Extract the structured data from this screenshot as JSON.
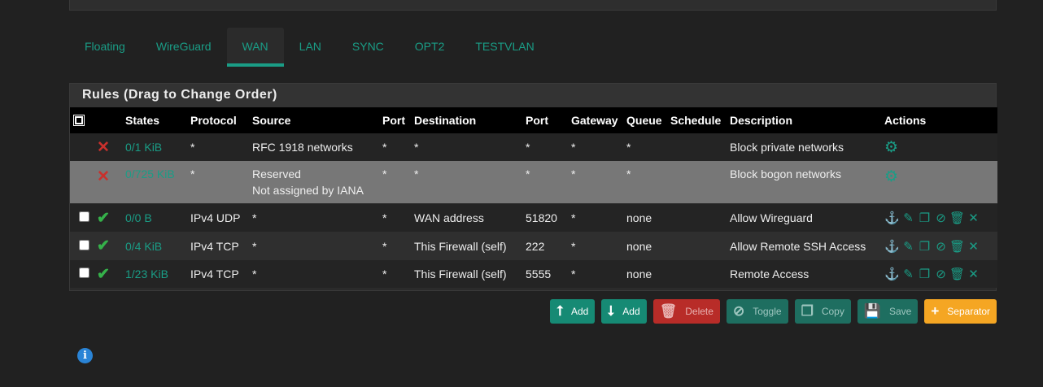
{
  "tabs": [
    {
      "label": "Floating",
      "active": false
    },
    {
      "label": "WireGuard",
      "active": false
    },
    {
      "label": "WAN",
      "active": true
    },
    {
      "label": "LAN",
      "active": false
    },
    {
      "label": "SYNC",
      "active": false
    },
    {
      "label": "OPT2",
      "active": false
    },
    {
      "label": "TESTVLAN",
      "active": false
    }
  ],
  "panel": {
    "title": "Rules (Drag to Change Order)"
  },
  "columns": [
    "States",
    "Protocol",
    "Source",
    "Port",
    "Destination",
    "Port",
    "Gateway",
    "Queue",
    "Schedule",
    "Description",
    "Actions"
  ],
  "rules": [
    {
      "status_icon": "block-x-icon",
      "states": "0/1 KiB",
      "protocol": "*",
      "source": "RFC 1918 networks",
      "source2": "",
      "sport": "*",
      "destination": "*",
      "dport": "*",
      "gateway": "*",
      "queue": "*",
      "schedule": "",
      "description": "Block private networks"
    },
    {
      "status_icon": "block-x-icon",
      "states": "0/725 KiB",
      "protocol": "*",
      "source": "Reserved",
      "source2": "Not assigned by IANA",
      "sport": "*",
      "destination": "*",
      "dport": "*",
      "gateway": "*",
      "queue": "*",
      "schedule": "",
      "description": "Block bogon networks"
    },
    {
      "status_icon": "pass-check-icon",
      "states": "0/0 B",
      "protocol": "IPv4 UDP",
      "source": "*",
      "source2": "",
      "sport": "*",
      "destination": "WAN address",
      "dport": "51820",
      "gateway": "*",
      "queue": "none",
      "schedule": "",
      "description": "Allow Wireguard"
    },
    {
      "status_icon": "pass-check-icon",
      "states": "0/4 KiB",
      "protocol": "IPv4 TCP",
      "source": "*",
      "source2": "",
      "sport": "*",
      "destination": "This Firewall (self)",
      "dport": "222",
      "gateway": "*",
      "queue": "none",
      "schedule": "",
      "description": "Allow Remote SSH Access"
    },
    {
      "status_icon": "pass-check-icon",
      "states": "1/23 KiB",
      "protocol": "IPv4 TCP",
      "source": "*",
      "source2": "",
      "sport": "*",
      "destination": "This Firewall (self)",
      "dport": "5555",
      "gateway": "*",
      "queue": "none",
      "schedule": "",
      "description": "Remote Access"
    }
  ],
  "buttons": {
    "add_top": "Add",
    "add_bottom": "Add",
    "delete": "Delete",
    "toggle": "Toggle",
    "copy": "Copy",
    "save": "Save",
    "separator": "Separator"
  },
  "colors": {
    "accent": "#1a9d86",
    "block": "#c9302c",
    "pass": "#35b14a",
    "separator": "#f5a623",
    "info": "#2a84d6"
  }
}
